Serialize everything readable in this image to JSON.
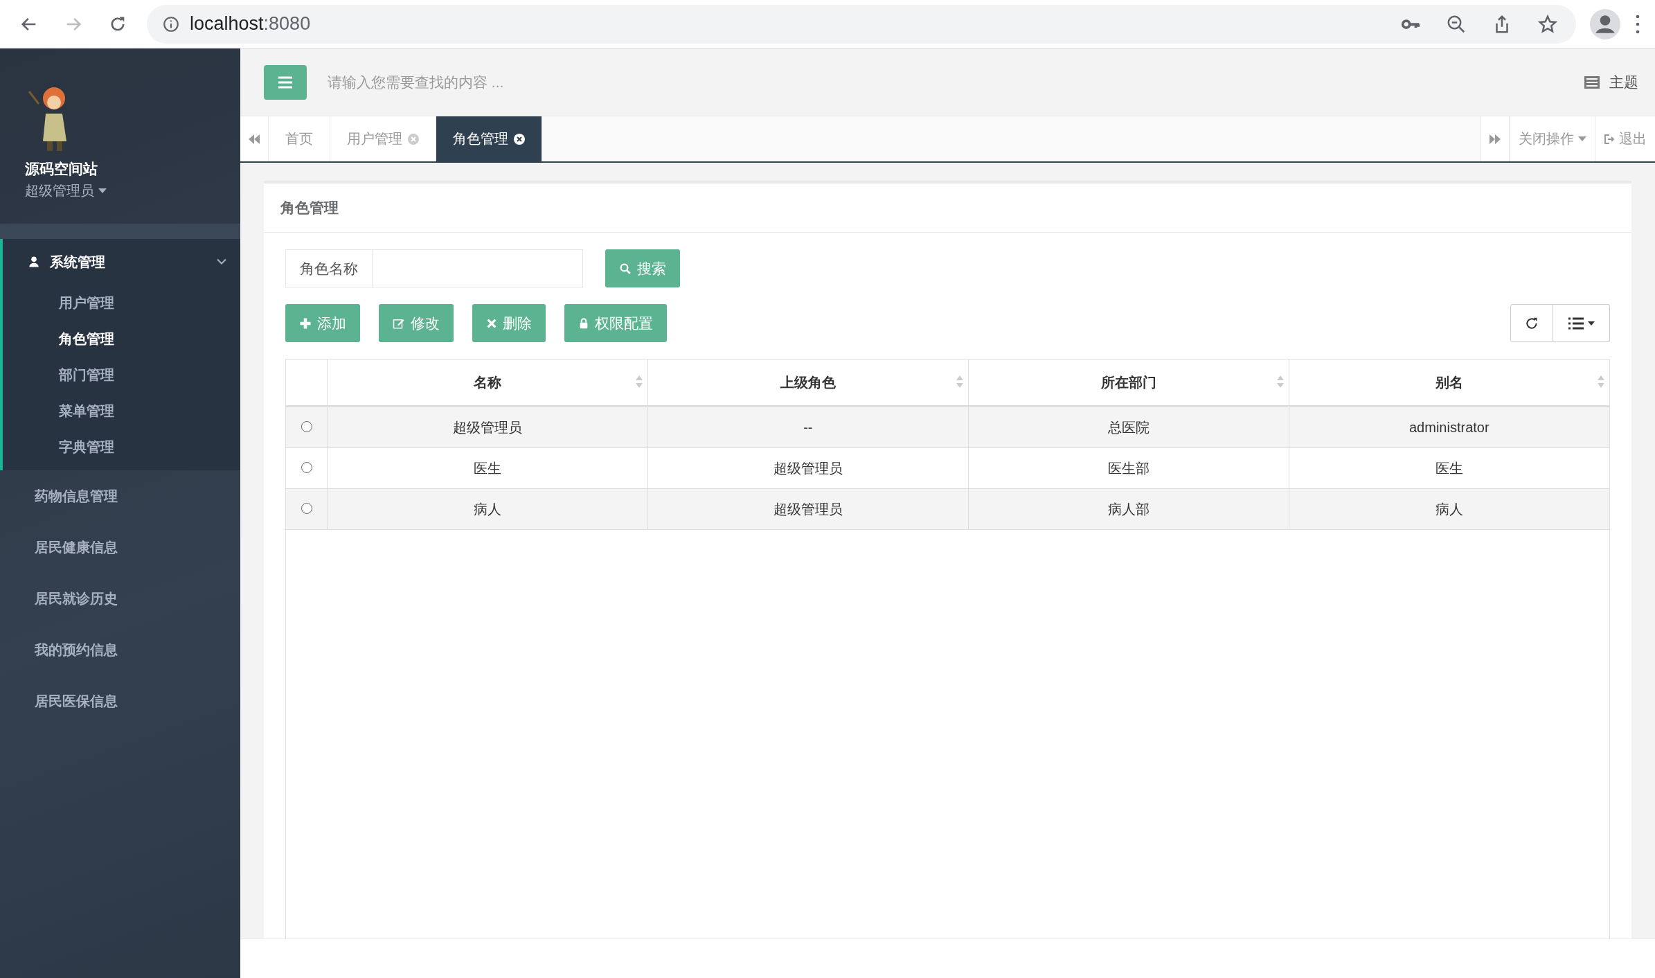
{
  "browser": {
    "url_host": "localhost",
    "url_port": ":8080"
  },
  "sidebar": {
    "user": {
      "name": "源码空间站",
      "role": "超级管理员"
    },
    "menu": [
      {
        "label": "系统管理",
        "expanded": true,
        "children": [
          {
            "label": "用户管理",
            "selected": false
          },
          {
            "label": "角色管理",
            "selected": true
          },
          {
            "label": "部门管理",
            "selected": false
          },
          {
            "label": "菜单管理",
            "selected": false
          },
          {
            "label": "字典管理",
            "selected": false
          }
        ]
      },
      {
        "label": "药物信息管理",
        "expanded": false
      },
      {
        "label": "居民健康信息",
        "expanded": false
      },
      {
        "label": "居民就诊历史",
        "expanded": false
      },
      {
        "label": "我的预约信息",
        "expanded": false
      },
      {
        "label": "居民医保信息",
        "expanded": false
      }
    ]
  },
  "header": {
    "search_placeholder": "请输入您需要查找的内容 ...",
    "theme": "主题"
  },
  "tabs": [
    {
      "label": "首页",
      "selected": false,
      "closable": false
    },
    {
      "label": "用户管理",
      "selected": false,
      "closable": true
    },
    {
      "label": "角色管理",
      "selected": true,
      "closable": true
    }
  ],
  "tab_actions": {
    "close_menu": "关闭操作",
    "logout": "退出"
  },
  "panel": {
    "title": "角色管理",
    "search": {
      "label": "角色名称",
      "button": "搜索"
    },
    "actions": [
      {
        "kind": "add",
        "label": "添加"
      },
      {
        "kind": "edit",
        "label": "修改"
      },
      {
        "kind": "delete",
        "label": "删除"
      },
      {
        "kind": "permission",
        "label": "权限配置"
      }
    ],
    "table": {
      "columns": [
        "名称",
        "上级角色",
        "所在部门",
        "别名"
      ],
      "rows": [
        {
          "selected": false,
          "cells": [
            "超级管理员",
            "--",
            "总医院",
            "administrator"
          ]
        },
        {
          "selected": false,
          "cells": [
            "医生",
            "超级管理员",
            "医生部",
            "医生"
          ]
        },
        {
          "selected": false,
          "cells": [
            "病人",
            "超级管理员",
            "病人部",
            "病人"
          ]
        }
      ]
    }
  }
}
